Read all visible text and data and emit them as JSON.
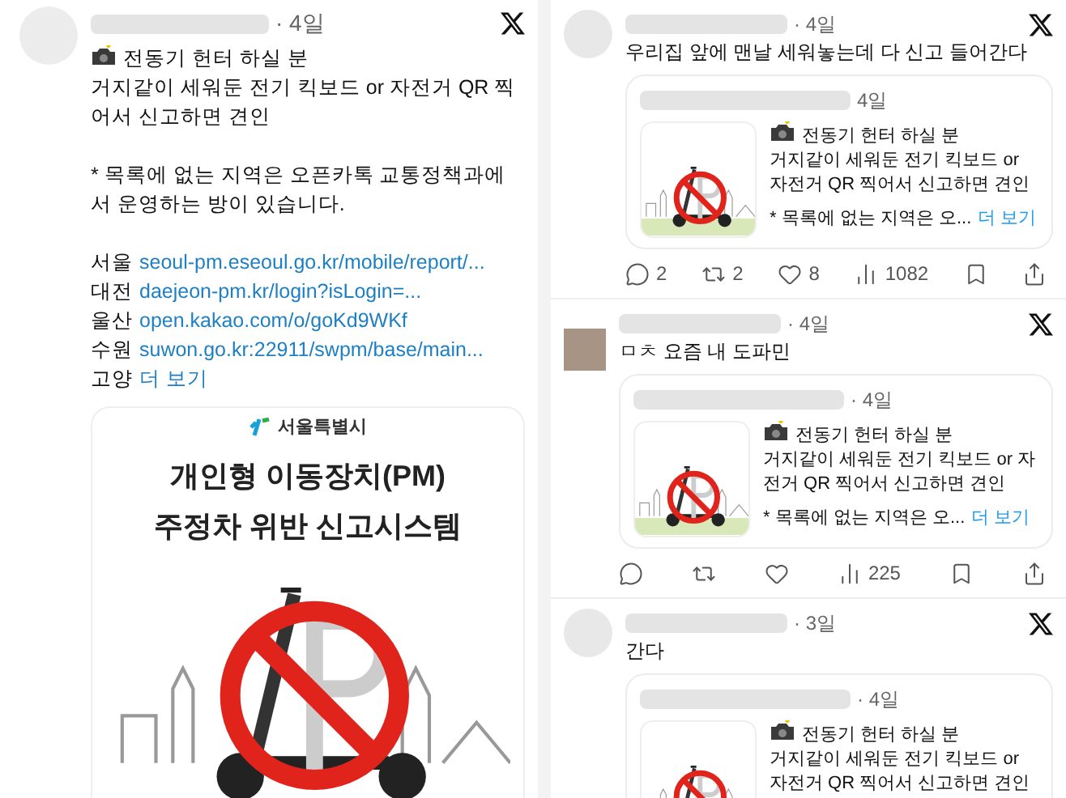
{
  "main_post": {
    "time": "· 4일",
    "title": "전동기 헌터 하실 분",
    "body": "거지같이 세워둔 전기 킥보드 or 자전거 QR 찍어서 신고하면 견인",
    "note": "* 목록에 없는 지역은 오픈카톡 교통정책과에서 운영하는 방이 있습니다.",
    "links": [
      {
        "city": "서울",
        "url": "seoul-pm.eseoul.go.kr/mobile/report/..."
      },
      {
        "city": "대전",
        "url": "daejeon-pm.kr/login?isLogin=..."
      },
      {
        "city": "울산",
        "url": "open.kakao.com/o/goKd9WKf"
      },
      {
        "city": "수원",
        "url": "suwon.go.kr:22911/swpm/base/main..."
      },
      {
        "city": "고양",
        "url": "더 보기"
      }
    ],
    "image": {
      "org": "서울특별시",
      "headline": [
        "개인형 이동장치(PM)",
        "주정차 위반 신고시스템"
      ]
    }
  },
  "replies": [
    {
      "time": "· 4일",
      "text": "우리집 앞에 맨날 세워놓는데 다 신고 들어간다",
      "kind": "blurred",
      "quote": {
        "time": "4일",
        "title": "전동기 헌터 하실 분",
        "body": "거지같이 세워둔 전기 킥보드 or 자전거 QR 찍어서 신고하면 견인",
        "note": "* 목록에 없는 지역은 오...",
        "more": "더 보기"
      },
      "actions": [
        {
          "kind": "reply",
          "count": "2"
        },
        {
          "kind": "repost",
          "count": "2"
        },
        {
          "kind": "like",
          "count": "8"
        },
        {
          "kind": "views",
          "count": "1082"
        },
        {
          "kind": "bookmark"
        },
        {
          "kind": "share"
        }
      ]
    },
    {
      "time": "· 4일",
      "text": "ㅁㅊ 요즘 내 도파민",
      "kind": "square",
      "quote": {
        "time": "· 4일",
        "title": "전동기 헌터 하실 분",
        "body": "거지같이 세워둔 전기 킥보드 or 자전거 QR 찍어서 신고하면 견인",
        "note": "* 목록에 없는 지역은 오...",
        "more": "더 보기"
      },
      "actions": [
        {
          "kind": "reply"
        },
        {
          "kind": "repost"
        },
        {
          "kind": "like"
        },
        {
          "kind": "views",
          "count": "225"
        },
        {
          "kind": "bookmark"
        },
        {
          "kind": "share"
        }
      ]
    },
    {
      "time": "· 3일",
      "text": "간다",
      "kind": "blurred",
      "quote": {
        "time": "· 4일",
        "title": "전동기 헌터 하실 분",
        "body": "거지같이 세워둔 전기 킥보드 or 자전거 QR 찍어서 신고하면 견인"
      }
    }
  ]
}
